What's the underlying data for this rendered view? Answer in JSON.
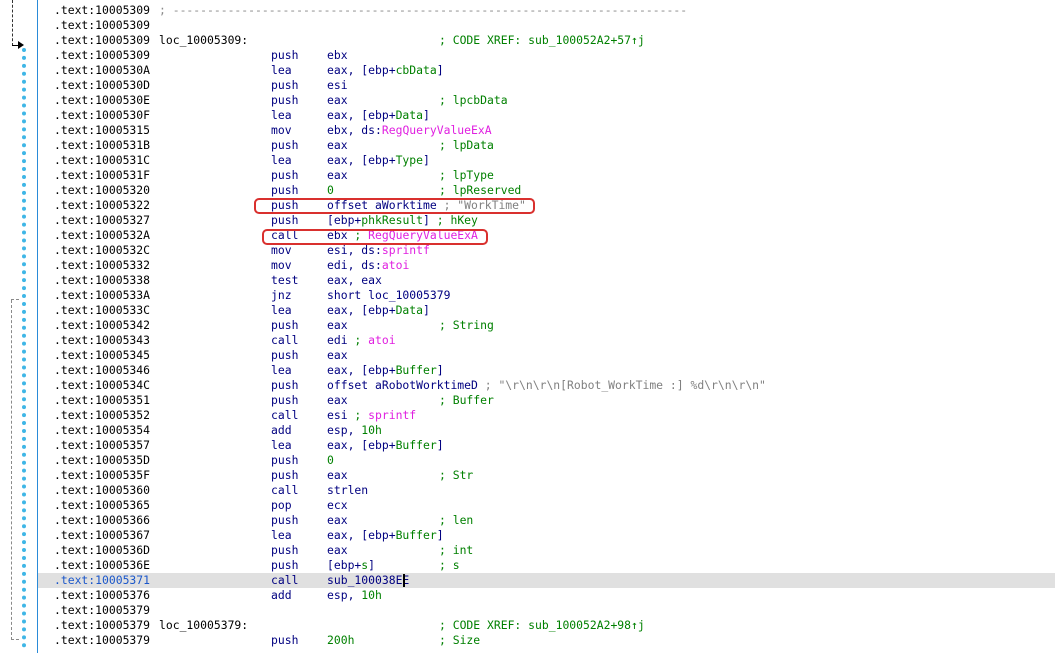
{
  "view": "IDA View",
  "rows": [
    {
      "addr": ".text:10005309",
      "sep": "; ---------------------------------------------------------------------------"
    },
    {
      "addr": ".text:10005309"
    },
    {
      "addr": ".text:10005309",
      "label": "loc_10005309:",
      "xref": "; CODE XREF: sub_100052A2+57↑j"
    },
    {
      "addr": ".text:10005309",
      "mnem": "push",
      "segs": [
        {
          "t": "ebx",
          "c": "navy"
        }
      ]
    },
    {
      "addr": ".text:1000530A",
      "mnem": "lea",
      "segs": [
        {
          "t": "eax, [ebp+",
          "c": "navy"
        },
        {
          "t": "cbData",
          "c": "green"
        },
        {
          "t": "]",
          "c": "navy"
        }
      ]
    },
    {
      "addr": ".text:1000530D",
      "mnem": "push",
      "segs": [
        {
          "t": "esi",
          "c": "navy"
        }
      ]
    },
    {
      "addr": ".text:1000530E",
      "mnem": "push",
      "segs": [
        {
          "t": "eax",
          "c": "navy"
        }
      ],
      "comment": "; lpcbData"
    },
    {
      "addr": ".text:1000530F",
      "mnem": "lea",
      "segs": [
        {
          "t": "eax, [ebp+",
          "c": "navy"
        },
        {
          "t": "Data",
          "c": "green"
        },
        {
          "t": "]",
          "c": "navy"
        }
      ]
    },
    {
      "addr": ".text:10005315",
      "mnem": "mov",
      "segs": [
        {
          "t": "ebx, ds:",
          "c": "navy"
        },
        {
          "t": "RegQueryValueExA",
          "c": "pink"
        }
      ]
    },
    {
      "addr": ".text:1000531B",
      "mnem": "push",
      "segs": [
        {
          "t": "eax",
          "c": "navy"
        }
      ],
      "comment": "; lpData"
    },
    {
      "addr": ".text:1000531C",
      "mnem": "lea",
      "segs": [
        {
          "t": "eax, [ebp+",
          "c": "navy"
        },
        {
          "t": "Type",
          "c": "green"
        },
        {
          "t": "]",
          "c": "navy"
        }
      ]
    },
    {
      "addr": ".text:1000531F",
      "mnem": "push",
      "segs": [
        {
          "t": "eax",
          "c": "navy"
        }
      ],
      "comment": "; lpType"
    },
    {
      "addr": ".text:10005320",
      "mnem": "push",
      "segs": [
        {
          "t": "0",
          "c": "green"
        }
      ],
      "comment": "; lpReserved"
    },
    {
      "addr": ".text:10005322",
      "mnem": "push",
      "segs": [
        {
          "t": "offset aWorktime",
          "c": "navy"
        },
        {
          "t": " ; \"WorkTime\"",
          "c": "gray"
        }
      ]
    },
    {
      "addr": ".text:10005327",
      "mnem": "push",
      "segs": [
        {
          "t": "[ebp+",
          "c": "navy"
        },
        {
          "t": "phkResult",
          "c": "green"
        },
        {
          "t": "]",
          "c": "navy"
        },
        {
          "t": " ; hKey",
          "c": "green"
        }
      ]
    },
    {
      "addr": ".text:1000532A",
      "mnem": "call",
      "segs": [
        {
          "t": "ebx",
          "c": "navy"
        },
        {
          "t": " ; ",
          "c": "green"
        },
        {
          "t": "RegQueryValueExA",
          "c": "pink"
        }
      ]
    },
    {
      "addr": ".text:1000532C",
      "mnem": "mov",
      "segs": [
        {
          "t": "esi, ds:",
          "c": "navy"
        },
        {
          "t": "sprintf",
          "c": "pink"
        }
      ]
    },
    {
      "addr": ".text:10005332",
      "mnem": "mov",
      "segs": [
        {
          "t": "edi, ds:",
          "c": "navy"
        },
        {
          "t": "atoi",
          "c": "pink"
        }
      ]
    },
    {
      "addr": ".text:10005338",
      "mnem": "test",
      "segs": [
        {
          "t": "eax, eax",
          "c": "navy"
        }
      ]
    },
    {
      "addr": ".text:1000533A",
      "mnem": "jnz",
      "segs": [
        {
          "t": "short loc_10005379",
          "c": "navy"
        }
      ]
    },
    {
      "addr": ".text:1000533C",
      "mnem": "lea",
      "segs": [
        {
          "t": "eax, [ebp+",
          "c": "navy"
        },
        {
          "t": "Data",
          "c": "green"
        },
        {
          "t": "]",
          "c": "navy"
        }
      ]
    },
    {
      "addr": ".text:10005342",
      "mnem": "push",
      "segs": [
        {
          "t": "eax",
          "c": "navy"
        }
      ],
      "comment": "; String"
    },
    {
      "addr": ".text:10005343",
      "mnem": "call",
      "segs": [
        {
          "t": "edi",
          "c": "navy"
        },
        {
          "t": " ; ",
          "c": "green"
        },
        {
          "t": "atoi",
          "c": "pink"
        }
      ]
    },
    {
      "addr": ".text:10005345",
      "mnem": "push",
      "segs": [
        {
          "t": "eax",
          "c": "navy"
        }
      ]
    },
    {
      "addr": ".text:10005346",
      "mnem": "lea",
      "segs": [
        {
          "t": "eax, [ebp+",
          "c": "navy"
        },
        {
          "t": "Buffer",
          "c": "green"
        },
        {
          "t": "]",
          "c": "navy"
        }
      ]
    },
    {
      "addr": ".text:1000534C",
      "mnem": "push",
      "segs": [
        {
          "t": "offset aRobotWorktimeD",
          "c": "navy"
        },
        {
          "t": " ; \"\\r\\n\\r\\n[Robot_WorkTime :] %d\\r\\n\\r\\n\"",
          "c": "gray"
        }
      ]
    },
    {
      "addr": ".text:10005351",
      "mnem": "push",
      "segs": [
        {
          "t": "eax",
          "c": "navy"
        }
      ],
      "comment": "; Buffer"
    },
    {
      "addr": ".text:10005352",
      "mnem": "call",
      "segs": [
        {
          "t": "esi",
          "c": "navy"
        },
        {
          "t": " ; ",
          "c": "green"
        },
        {
          "t": "sprintf",
          "c": "pink"
        }
      ]
    },
    {
      "addr": ".text:10005354",
      "mnem": "add",
      "segs": [
        {
          "t": "esp, ",
          "c": "navy"
        },
        {
          "t": "10h",
          "c": "green"
        }
      ]
    },
    {
      "addr": ".text:10005357",
      "mnem": "lea",
      "segs": [
        {
          "t": "eax, [ebp+",
          "c": "navy"
        },
        {
          "t": "Buffer",
          "c": "green"
        },
        {
          "t": "]",
          "c": "navy"
        }
      ]
    },
    {
      "addr": ".text:1000535D",
      "mnem": "push",
      "segs": [
        {
          "t": "0",
          "c": "green"
        }
      ]
    },
    {
      "addr": ".text:1000535F",
      "mnem": "push",
      "segs": [
        {
          "t": "eax",
          "c": "navy"
        }
      ],
      "comment": "; Str"
    },
    {
      "addr": ".text:10005360",
      "mnem": "call",
      "segs": [
        {
          "t": "strlen",
          "c": "navy"
        }
      ]
    },
    {
      "addr": ".text:10005365",
      "mnem": "pop",
      "segs": [
        {
          "t": "ecx",
          "c": "navy"
        }
      ]
    },
    {
      "addr": ".text:10005366",
      "mnem": "push",
      "segs": [
        {
          "t": "eax",
          "c": "navy"
        }
      ],
      "comment": "; len"
    },
    {
      "addr": ".text:10005367",
      "mnem": "lea",
      "segs": [
        {
          "t": "eax, [ebp+",
          "c": "navy"
        },
        {
          "t": "Buffer",
          "c": "green"
        },
        {
          "t": "]",
          "c": "navy"
        }
      ]
    },
    {
      "addr": ".text:1000536D",
      "mnem": "push",
      "segs": [
        {
          "t": "eax",
          "c": "navy"
        }
      ],
      "comment": "; int"
    },
    {
      "addr": ".text:1000536E",
      "mnem": "push",
      "segs": [
        {
          "t": "[ebp+",
          "c": "navy"
        },
        {
          "t": "s",
          "c": "green"
        },
        {
          "t": "]",
          "c": "navy"
        }
      ],
      "comment": "; s"
    },
    {
      "addr": ".text:10005371",
      "mnem": "call",
      "segs": [
        {
          "t": "sub_100038EE",
          "c": "navy"
        }
      ],
      "selected": true
    },
    {
      "addr": ".text:10005376",
      "mnem": "add",
      "segs": [
        {
          "t": "esp, ",
          "c": "navy"
        },
        {
          "t": "10h",
          "c": "green"
        }
      ]
    },
    {
      "addr": ".text:10005379"
    },
    {
      "addr": ".text:10005379",
      "label": "loc_10005379:",
      "xref": "; CODE XREF: sub_100052A2+98↑j"
    },
    {
      "addr": ".text:10005379",
      "mnem": "push",
      "segs": [
        {
          "t": "200h",
          "c": "green"
        }
      ],
      "comment": "; Size"
    }
  ]
}
